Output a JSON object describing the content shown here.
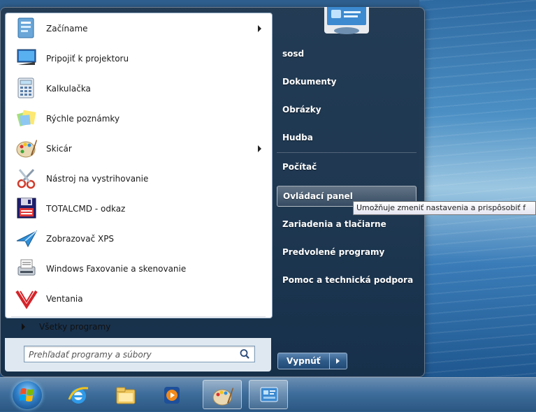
{
  "start_menu": {
    "programs": [
      {
        "label": "Začíname",
        "icon": "getting-started-icon",
        "submenu": true
      },
      {
        "label": "Pripojiť k projektoru",
        "icon": "projector-icon",
        "submenu": false
      },
      {
        "label": "Kalkulačka",
        "icon": "calculator-icon",
        "submenu": false
      },
      {
        "label": "Rýchle poznámky",
        "icon": "sticky-notes-icon",
        "submenu": false
      },
      {
        "label": "Skicár",
        "icon": "paint-icon",
        "submenu": true
      },
      {
        "label": "Nástroj na vystrihovanie",
        "icon": "scissors-icon",
        "submenu": false
      },
      {
        "label": "TOTALCMD - odkaz",
        "icon": "floppy-disk-icon",
        "submenu": false
      },
      {
        "label": "Zobrazovač XPS",
        "icon": "xps-viewer-icon",
        "submenu": false
      },
      {
        "label": "Windows Faxovanie a skenovanie",
        "icon": "fax-scanner-icon",
        "submenu": false
      },
      {
        "label": "Ventania",
        "icon": "ventania-logo-icon",
        "submenu": false
      }
    ],
    "all_programs": "Všetky programy",
    "search": {
      "placeholder": "Prehľadať programy a súbory"
    },
    "right_links": [
      {
        "label": "sosd"
      },
      {
        "label": "Dokumenty"
      },
      {
        "label": "Obrázky"
      },
      {
        "label": "Hudba"
      },
      {
        "label": "Počítač"
      },
      {
        "label": "Ovládací panel",
        "hovered": true
      },
      {
        "label": "Zariadenia a tlačiarne"
      },
      {
        "label": "Predvolené programy"
      },
      {
        "label": "Pomoc a technická podpora"
      }
    ],
    "tooltip": "Umožňuje zmeniť nastavenia a prispôsobiť f",
    "shutdown": "Vypnúť"
  },
  "taskbar": {
    "items": [
      {
        "icon": "internet-explorer-icon"
      },
      {
        "icon": "file-explorer-icon"
      },
      {
        "icon": "media-player-icon"
      },
      {
        "icon": "paint-icon",
        "active": true
      },
      {
        "icon": "control-panel-icon",
        "active": true
      }
    ]
  }
}
